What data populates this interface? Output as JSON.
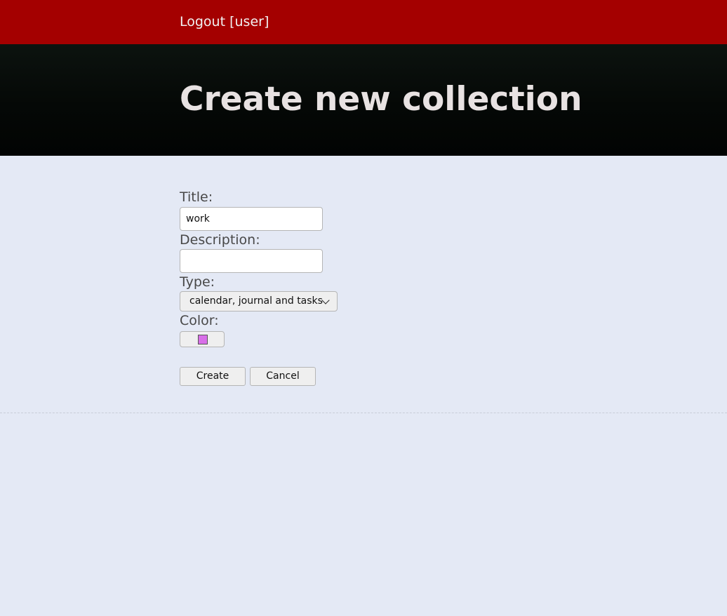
{
  "header": {
    "logout_label": "Logout [user]"
  },
  "page": {
    "title": "Create new collection"
  },
  "form": {
    "title_label": "Title:",
    "title_value": "work",
    "description_label": "Description:",
    "description_value": "",
    "type_label": "Type:",
    "type_value": "calendar, journal and tasks",
    "color_label": "Color:",
    "color_value": "#d86fe8"
  },
  "actions": {
    "create_label": "Create",
    "cancel_label": "Cancel"
  },
  "colors": {
    "topbar": "#a40000",
    "background": "#e4e9f5"
  },
  "icons": {
    "select_arrow": "chevron-down-icon"
  }
}
